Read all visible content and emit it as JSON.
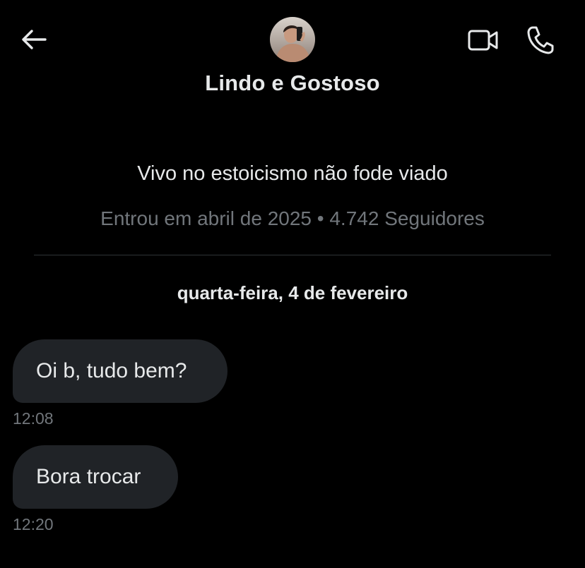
{
  "header": {
    "contact_name": "Lindo e Gostoso",
    "icons": {
      "back": "back-arrow-icon",
      "video": "video-camera-icon",
      "call": "phone-icon"
    }
  },
  "profile": {
    "bio": "Vivo no estoicismo não fode viado",
    "meta": "Entrou em abril de 2025 • 4.742 Seguidores"
  },
  "conversation": {
    "date_separator": "quarta-feira, 4 de fevereiro",
    "messages": [
      {
        "text": "Oi b, tudo bem?",
        "time": "12:08"
      },
      {
        "text": "Bora trocar",
        "time": "12:20"
      }
    ]
  },
  "colors": {
    "background": "#000000",
    "primary_text": "#e7e9ea",
    "secondary_text": "#71767b",
    "bubble": "#202327",
    "divider": "#2f3336"
  }
}
